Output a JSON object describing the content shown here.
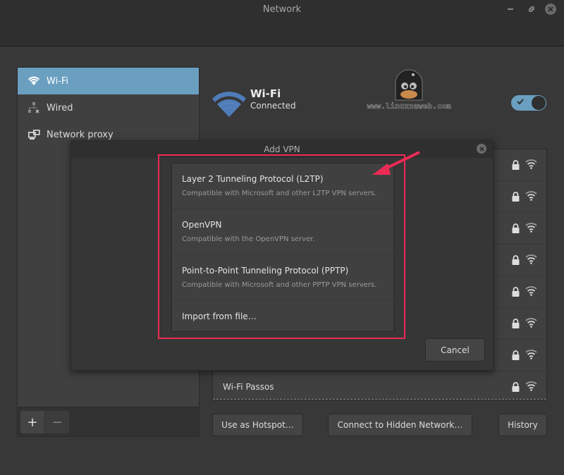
{
  "window": {
    "title": "Network",
    "controls": [
      "minimize",
      "maximize",
      "close"
    ]
  },
  "sidebar": {
    "items": [
      {
        "label": "Wi-Fi",
        "icon": "wifi-icon",
        "active": true
      },
      {
        "label": "Wired",
        "icon": "wired-network-icon",
        "active": false
      },
      {
        "label": "Network proxy",
        "icon": "network-proxy-icon",
        "active": false
      }
    ],
    "add_label": "+",
    "remove_label": "−"
  },
  "wifi": {
    "title": "Wi-Fi",
    "status": "Connected",
    "enabled": true
  },
  "watermark": {
    "text": "www.linuxnaweb.com"
  },
  "networks": [
    {
      "name": "",
      "secured": true
    },
    {
      "name": "",
      "secured": true
    },
    {
      "name": "",
      "secured": true
    },
    {
      "name": "",
      "secured": true
    },
    {
      "name": "",
      "secured": true
    },
    {
      "name": "",
      "secured": true
    },
    {
      "name": "",
      "secured": true
    },
    {
      "name": "Wi-Fi Passos",
      "secured": true
    }
  ],
  "buttons": {
    "hotspot": "Use as Hotspot…",
    "hidden": "Connect to Hidden Network…",
    "history": "History"
  },
  "dialog": {
    "title": "Add VPN",
    "options": [
      {
        "title": "Layer 2 Tunneling Protocol (L2TP)",
        "description": "Compatible with Microsoft and other L2TP VPN servers."
      },
      {
        "title": "OpenVPN",
        "description": "Compatible with the OpenVPN server."
      },
      {
        "title": "Point-to-Point Tunneling Protocol (PPTP)",
        "description": "Compatible with Microsoft and other PPTP VPN servers."
      },
      {
        "title": "Import from file…",
        "description": ""
      }
    ],
    "cancel_label": "Cancel"
  },
  "annotation": {
    "highlight_color": "#ec2b55",
    "accent_color": "#6a9fc0"
  }
}
